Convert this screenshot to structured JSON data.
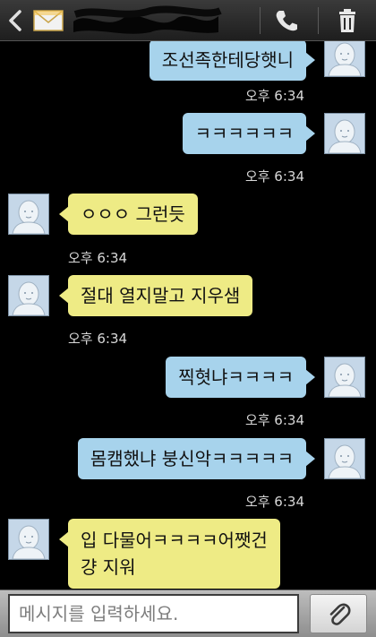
{
  "header": {
    "back_icon": "chevron-left-icon",
    "message_icon": "envelope-icon",
    "call_icon": "phone-icon",
    "delete_icon": "trash-icon"
  },
  "messages": [
    {
      "side": "out",
      "text": "조선족한테당햇니",
      "time": "오후 6:34"
    },
    {
      "side": "out",
      "text": "ㅋㅋㅋㅋㅋㅋ",
      "time": "오후 6:34"
    },
    {
      "side": "in",
      "text": "ㅇㅇㅇ 그런듯",
      "time": "오후 6:34"
    },
    {
      "side": "in",
      "text": "절대 열지말고 지우샘",
      "time": "오후 6:34"
    },
    {
      "side": "out",
      "text": "찍혓냐ㅋㅋㅋㅋ",
      "time": "오후 6:34"
    },
    {
      "side": "out",
      "text": "몸캠했냐 붕신악ㅋㅋㅋㅋㅋ",
      "time": "오후 6:34"
    },
    {
      "side": "in",
      "text_lines": [
        "입 다물어ㅋㅋㅋㅋ어쨋건",
        "걍 지워"
      ]
    }
  ],
  "compose": {
    "placeholder": "메시지를 입력하세요.",
    "attach_icon": "paperclip-icon"
  },
  "colors": {
    "background": "#000000",
    "outgoing_bubble": "#a7d3ec",
    "incoming_bubble": "#eeeb85",
    "timestamp": "#d8d8d8"
  }
}
